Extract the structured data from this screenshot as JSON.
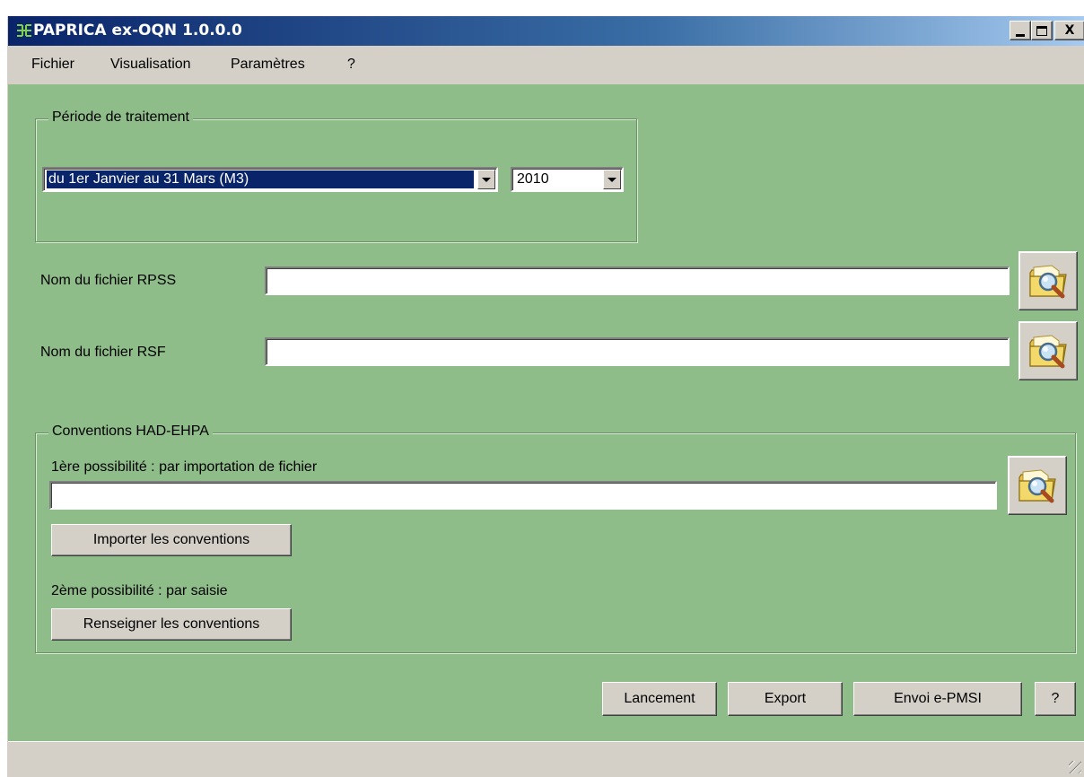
{
  "window": {
    "title": "PAPRICA ex-OQN 1.0.0.0",
    "close_glyph": "X"
  },
  "menu": {
    "items": [
      "Fichier",
      "Visualisation",
      "Paramètres",
      "?"
    ]
  },
  "periode": {
    "legend": "Période de traitement",
    "period_value": "du 1er Janvier au 31 Mars (M3)",
    "year_value": "2010"
  },
  "files": {
    "rpss_label": "Nom du fichier RPSS",
    "rpss_value": "",
    "rsf_label": "Nom du fichier RSF",
    "rsf_value": ""
  },
  "conventions": {
    "legend": "Conventions HAD-EHPA",
    "option1_label": "1ère possibilité : par importation de fichier",
    "import_file_value": "",
    "import_button": "Importer les conventions",
    "option2_label": "2ème possibilité : par saisie",
    "fill_button": "Renseigner les conventions"
  },
  "actions": {
    "launch": "Lancement",
    "export": "Export",
    "send": "Envoi e-PMSI",
    "help": "?"
  },
  "colors": {
    "background": "#8fbd8a",
    "titlebar": "#0a246a",
    "chrome": "#d4d0c8",
    "selection": "#0a246a"
  },
  "icons": [
    "app-icon",
    "minimize-icon",
    "maximize-icon",
    "close-icon",
    "dropdown-arrow-icon",
    "folder-search-icon",
    "resize-grip-icon"
  ]
}
